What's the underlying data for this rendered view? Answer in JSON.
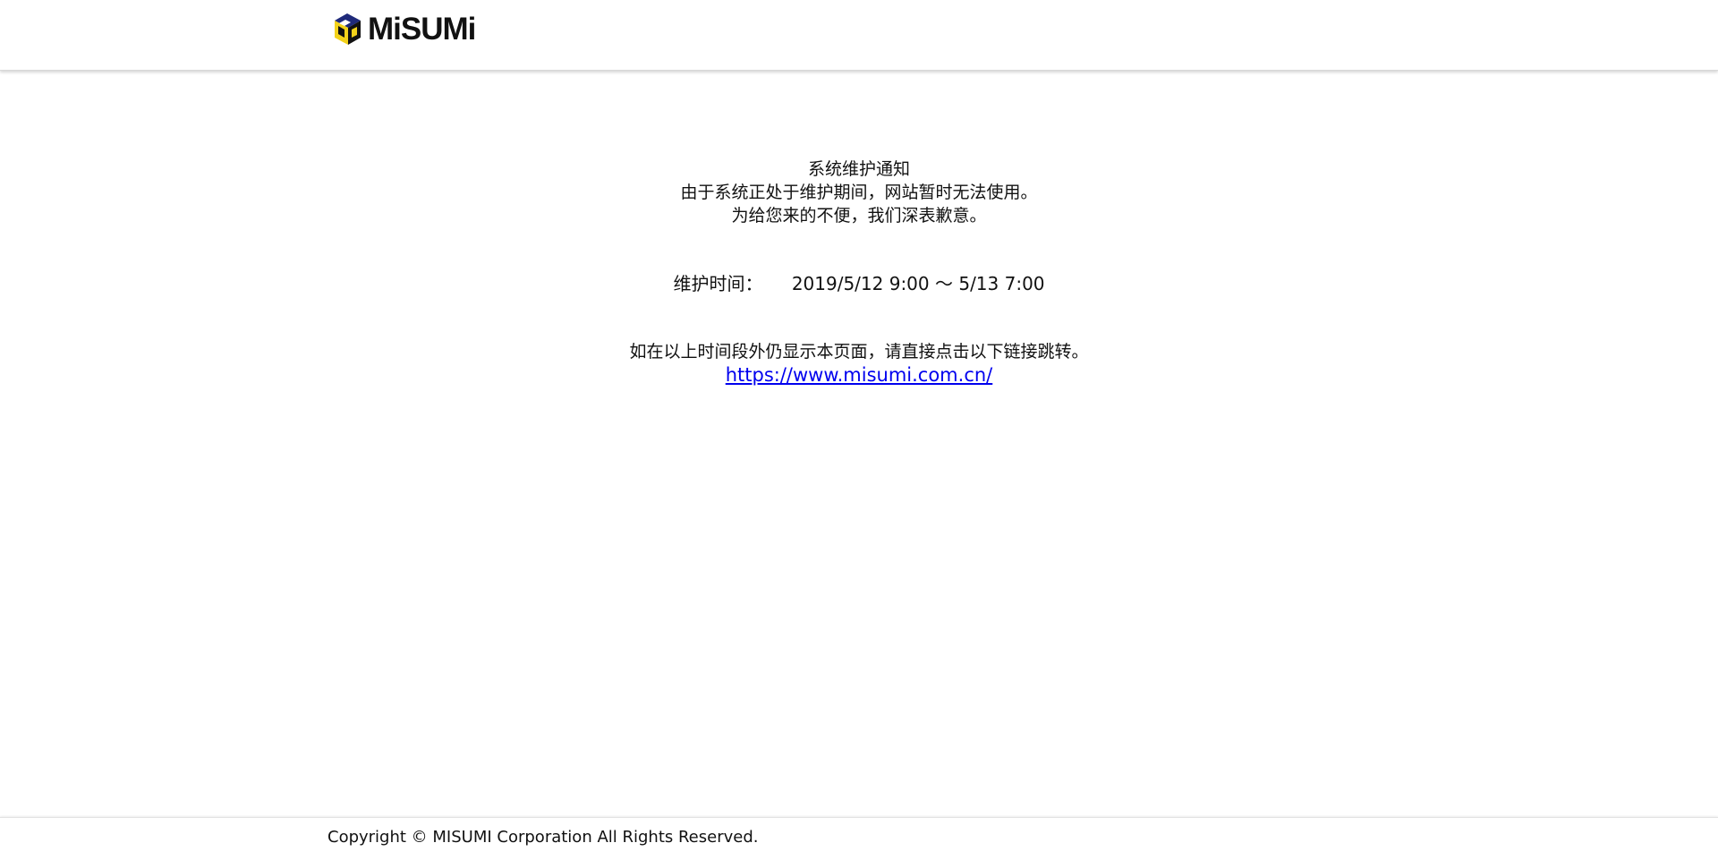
{
  "header": {
    "logo_text": "MiSUMi",
    "logo_icon": "misumi-cube-logo"
  },
  "notice": {
    "title": "系统维护通知",
    "line_1": "由于系统正处于维护期间，网站暂时无法使用。",
    "line_2": "为给您来的不便，我们深表歉意。",
    "maintenance_label": "维护时间：",
    "maintenance_time": "2019/5/12 9:00 ～ 5/13 7:00",
    "redirect_text": "如在以上时间段外仍显示本页面，请直接点击以下链接跳转。",
    "link_text": "https://www.misumi.com.cn/",
    "link_href": "https://www.misumi.com.cn/"
  },
  "footer": {
    "copyright": "Copyright © MISUMI Corporation All Rights Reserved."
  },
  "colors": {
    "logo_blue": "#1f2a7a",
    "logo_yellow": "#f3d21a",
    "link_blue": "#0000ee"
  }
}
